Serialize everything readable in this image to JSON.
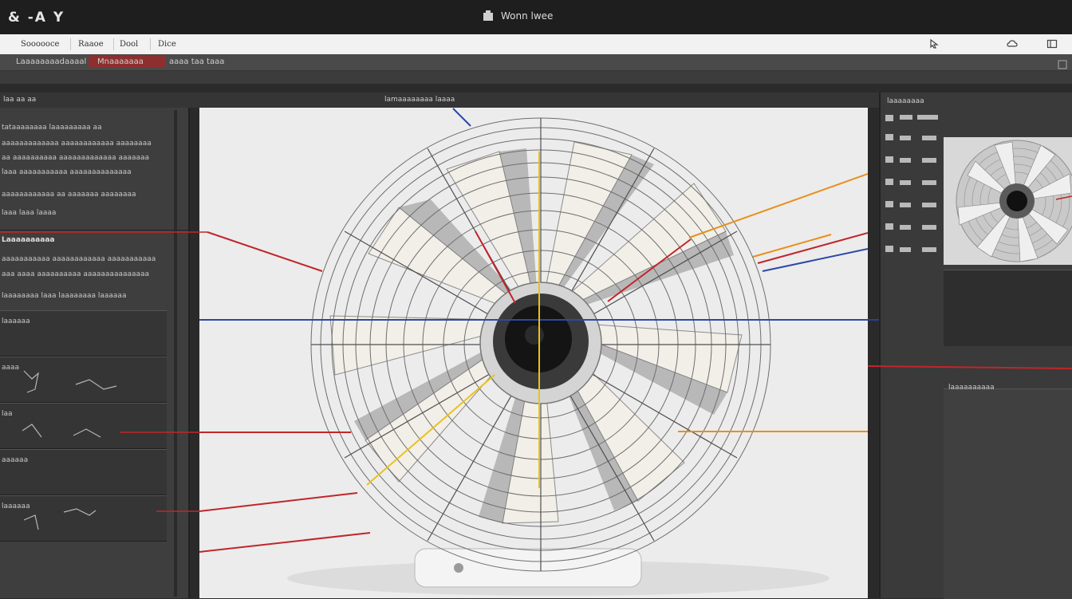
{
  "title_bar": {
    "left_text": "& -A Y",
    "center_text": "Wonn lwee"
  },
  "menu": {
    "items": [
      "Soooooce",
      "Raaoe",
      "Dool",
      "Dice"
    ]
  },
  "toolbar1": {
    "file_label": "Laaaaaaaadaaaal",
    "active_label": "Mnaaaaaaa",
    "right_label": "aaaa taa taaa"
  },
  "toolbar3": {
    "left_label": "laa aa aa",
    "canvas_label": "lamaaaaaaaa laaaa"
  },
  "left_panel": {
    "rows": [
      "tataaaaaaaa  laaaaaaaaa   aa",
      "aaaaaaaaaaaaa  aaaaaaaaaaaa aaaaaaaa",
      "aa aaaaaaaaaa  aaaaaaaaaaaaa aaaaaaa",
      "laaa aaaaaaaaaaa  aaaaaaaaaaaaaa",
      "aaaaaaaaaaaa aa aaaaaaa  aaaaaaaa",
      "laaa laaa laaaa"
    ],
    "section_head": "Laaaaaaaaaa",
    "section_rows": [
      "aaaaaaaaaaa aaaaaaaaaaaa aaaaaaaaaaa",
      "aaa aaaa aaaaaaaaaa aaaaaaaaaaaaaaa",
      "laaaaaaaa  laaa laaaaaaaa laaaaaa"
    ],
    "layers": [
      "laaaaaa",
      "aaaa",
      "laa",
      "aaaaaa",
      "laaaaaa"
    ]
  },
  "right_panel": {
    "top_label": "laaaaaaaa",
    "lower_label": "laaaaaaaaaa"
  },
  "colors": {
    "callout_red": "#c0262a",
    "callout_orange": "#e8901a",
    "callout_yellow": "#e8c21f",
    "callout_blue": "#2c49a8"
  }
}
